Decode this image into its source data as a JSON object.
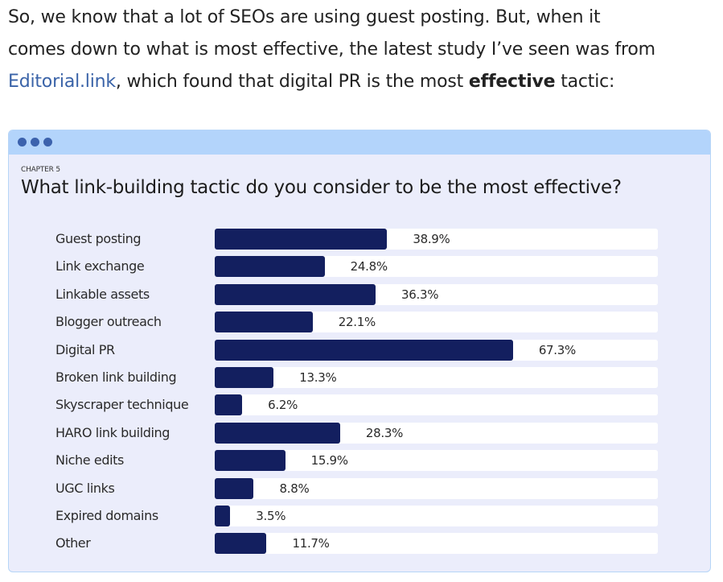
{
  "intro": {
    "line1": "So, we know that a lot of SEOs are using guest posting. But, when it",
    "line2": "comes down to what is most effective, the latest study I’ve seen was from",
    "link_text": "Editorial.link",
    "line3_mid": ", which found that digital PR is the most ",
    "bold_text": "effective",
    "line3_end": " tactic:"
  },
  "card": {
    "window_dots": [
      "dot-1",
      "dot-2",
      "dot-3"
    ],
    "colors": {
      "header": "#b3d4fb",
      "background": "#ebedfb",
      "bar": "#131f5f",
      "dot": "#3c62ad",
      "link": "#3a63a8"
    }
  },
  "chart_data": {
    "type": "bar",
    "orientation": "horizontal",
    "eyebrow": "CHAPTER 5",
    "title": "What link-building tactic do you consider to be the most effective?",
    "xlabel": "",
    "ylabel": "",
    "xlim": [
      0,
      100
    ],
    "unit": "%",
    "grid": false,
    "categories": [
      "Guest posting",
      "Link exchange",
      "Linkable assets",
      "Blogger outreach",
      "Digital PR",
      "Broken link building",
      "Skyscraper technique",
      "HARO link building",
      "Niche edits",
      "UGC links",
      "Expired domains",
      "Other"
    ],
    "values": [
      38.9,
      24.8,
      36.3,
      22.1,
      67.3,
      13.3,
      6.2,
      28.3,
      15.9,
      8.8,
      3.5,
      11.7
    ],
    "labels": [
      "38.9%",
      "24.8%",
      "36.3%",
      "22.1%",
      "67.3%",
      "13.3%",
      "6.2%",
      "28.3%",
      "15.9%",
      "8.8%",
      "3.5%",
      "11.7%"
    ]
  }
}
